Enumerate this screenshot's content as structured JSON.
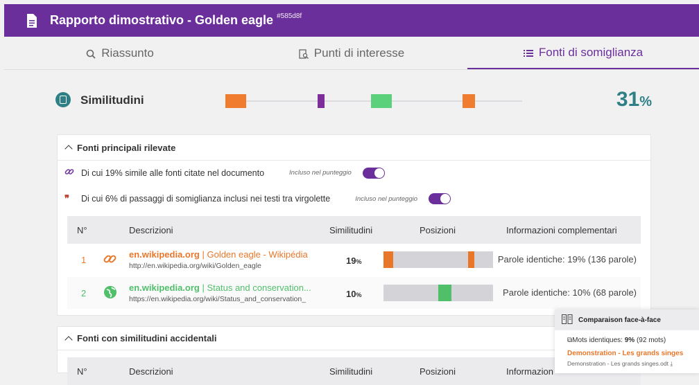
{
  "header": {
    "title": "Rapporto dimostrativo - Golden eagle",
    "id": "#585d8f",
    "icon": "document-icon"
  },
  "tabs": [
    {
      "label": "Riassunto",
      "icon": "magnifier-icon",
      "active": false
    },
    {
      "label": "Punti di interesse",
      "icon": "document-search-icon",
      "active": false
    },
    {
      "label": "Fonti di somiglianza",
      "icon": "list-icon",
      "active": true
    }
  ],
  "similarity": {
    "label": "Similitudini",
    "percent": "31",
    "unit": "%",
    "marks": [
      {
        "position": 0.0,
        "width": 0.07,
        "color": "#ef7c2f"
      },
      {
        "position": 0.31,
        "width": 0.025,
        "color": "#7d2e99"
      },
      {
        "position": 0.49,
        "width": 0.07,
        "color": "#5bd17b"
      },
      {
        "position": 0.8,
        "width": 0.04,
        "color": "#ef7c2f"
      }
    ]
  },
  "panel1": {
    "title": "Fonti principali rilevate",
    "rows": [
      {
        "text": "Di cui 19% simile alle fonti citate nel documento",
        "badge": "Incluso nel punteggio"
      },
      {
        "text": "Di cui 6% di passaggi di somiglianza inclusi nei testi tra virgolette",
        "badge": "Incluso nel punteggio"
      }
    ],
    "columns": [
      "N°",
      "Descrizioni",
      "Similitudini",
      "Posizioni",
      "Informazioni complementari"
    ],
    "sources": [
      {
        "num": "1",
        "domain": "en.wikipedia.org",
        "title": "| Golden eagle - Wikipédia",
        "url": "http://en.wikipedia.org/wiki/Golden_eagle",
        "percent": "19",
        "unit": "%",
        "info": "Parole identiche: 19% (136 parole)",
        "color": "#e9772a",
        "marks": [
          {
            "position": 0.0,
            "width": 0.09
          },
          {
            "position": 0.77,
            "width": 0.06
          }
        ]
      },
      {
        "num": "2",
        "domain": "en.wikipedia.org",
        "title": "| Status and conservation...",
        "url": "https://en.wikipedia.org/wiki/Status_and_conservation_",
        "percent": "10",
        "unit": "%",
        "info": "Parole identiche: 10% (68 parole)",
        "color": "#4fbf6a",
        "marks": [
          {
            "position": 0.5,
            "width": 0.12
          }
        ]
      }
    ]
  },
  "panel2": {
    "title": "Fonti con similitudini accidentali",
    "columns": [
      "N°",
      "Descrizioni",
      "Similitudini",
      "Posizioni",
      "Informazion"
    ]
  },
  "popup": {
    "title": "Comparaison face-à-face",
    "identical_prefix": "Mots identiques: ",
    "identical_value": "9%",
    "identical_suffix": " (92 mots)",
    "doc_title": "Demonstration - Les grands singes",
    "doc_file": "Demonstration - Les grands singes.odt"
  }
}
